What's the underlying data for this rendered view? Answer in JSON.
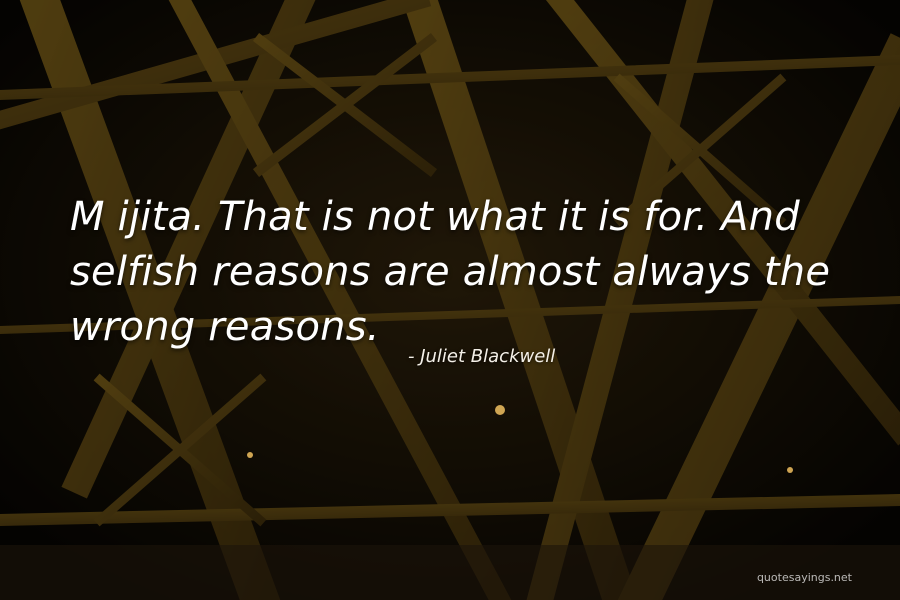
{
  "quote": {
    "text": "M ijita. That is not what it is for. And selfish reasons are almost always the wrong reasons.",
    "author": "- Juliet Blackwell"
  },
  "watermark": "quotesayings.net",
  "colors": {
    "background": "#120d06",
    "beam": "#8a6a1c",
    "beam_dark": "#3a2a0c",
    "text": "#ffffff"
  }
}
